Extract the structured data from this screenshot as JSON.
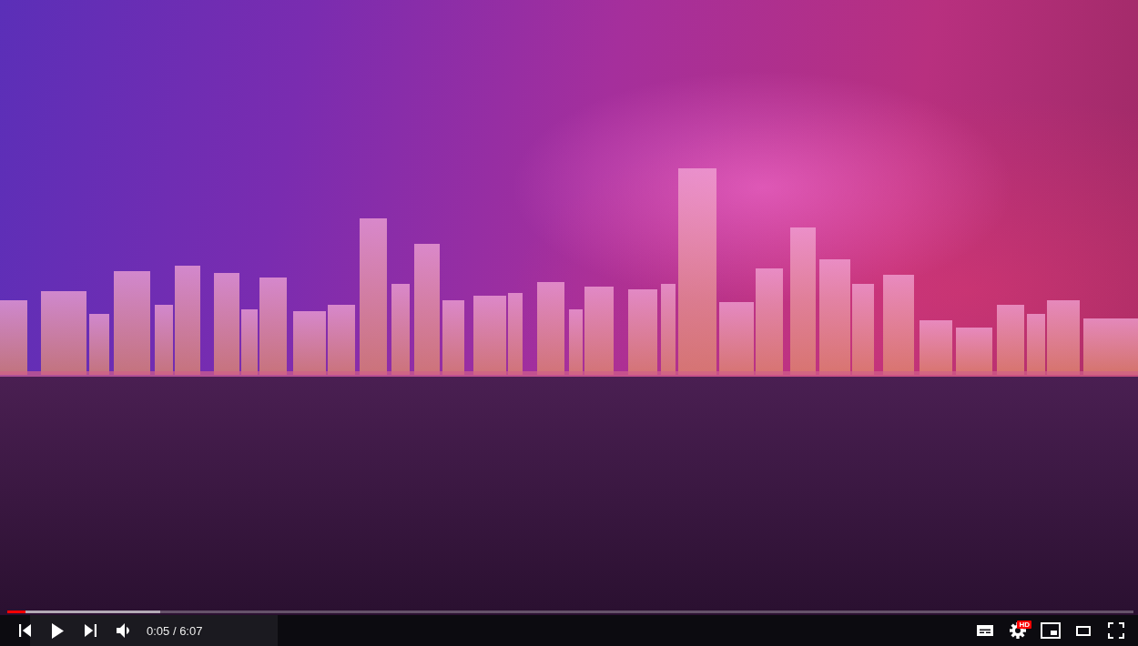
{
  "player": {
    "progress": {
      "level": 0.016,
      "buffered": {
        "level": 0.136
      }
    },
    "time": "0:05 / 6:07",
    "settings_badge": "HD"
  }
}
